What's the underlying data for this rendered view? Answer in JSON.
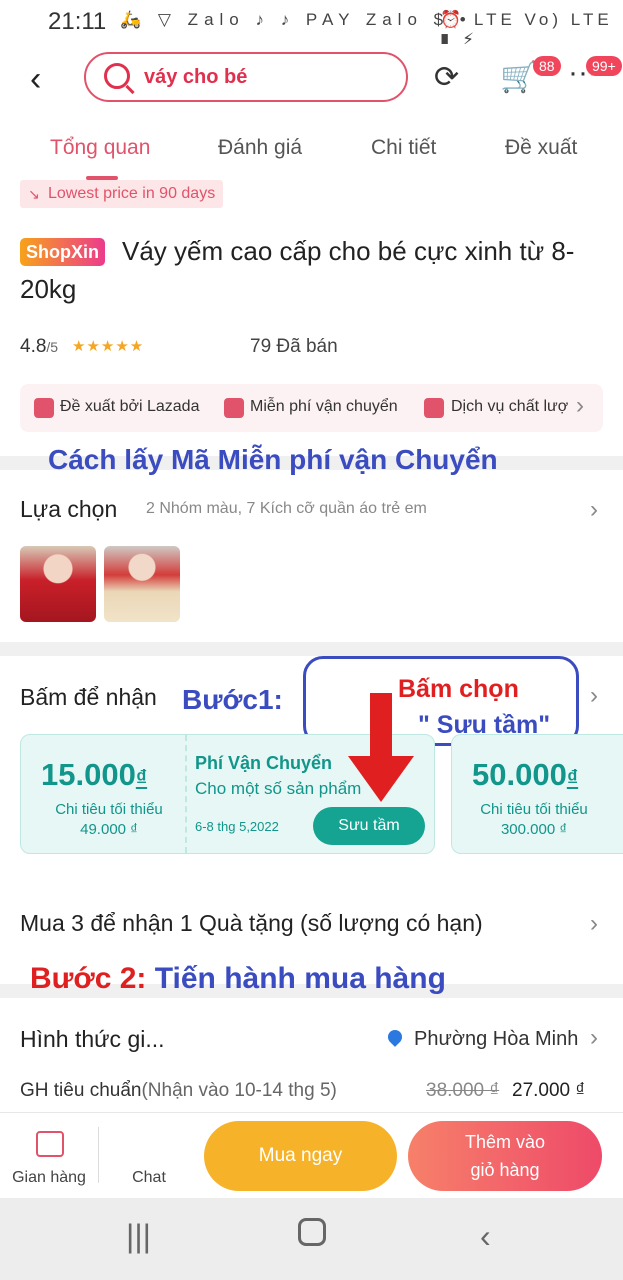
{
  "status_bar": {
    "time": "21:11",
    "left_icons": "🛵 ▽ Zalo ♪ ♪ PAY Zalo $ •",
    "right_icons": "⏰ LTE Vo) LTE ▮ ⚡"
  },
  "header": {
    "search_text": "váy cho bé",
    "cart_badge": "88",
    "more_badge": "99+"
  },
  "tabs": [
    "Tổng quan",
    "Đánh giá",
    "Chi tiết",
    "Đề xuất"
  ],
  "product": {
    "lowest_price": "Lowest price in 90 days",
    "shop_badge": "ShopXin",
    "title": "Váy yếm cao cấp cho bé cực xinh từ 8-20kg",
    "rating": "4.8",
    "rating_max": "/5",
    "stars": "★★★★★",
    "sold": "79  Đã bán",
    "services": [
      "Đề xuất bởi Lazada",
      "Miễn phí vận chuyển",
      "Dịch vụ chất lượ"
    ]
  },
  "guide_title": "Cách lấy Mã Miễn phí vận Chuyển",
  "selection": {
    "label": "Lựa chọn",
    "sub": "2 Nhóm màu, 7 Kích cỡ quần áo trẻ em"
  },
  "vouchers": {
    "label": "Bấm để nhận",
    "step1": "Bước1:",
    "callout_line1": "Bấm chọn",
    "callout_line2": "\" Sưu tầm\"",
    "coupon1": {
      "amount": "15.000",
      "currency": "₫",
      "min_label": "Chi tiêu tối thiểu",
      "min_value": "49.000 ₫"
    },
    "shipping": {
      "name": "Phí Vận Chuyển",
      "sub": "Cho một số sản phẩm",
      "date": "6-8 thg 5,2022",
      "button": "Sưu tầm"
    },
    "coupon2": {
      "amount": "50.000",
      "currency": "₫",
      "min_label": "Chi tiêu tối thiểu",
      "min_value": "300.000 ₫"
    }
  },
  "gift": {
    "label": "Mua 3 để nhận 1 Quà tặng (số lượng có hạn)"
  },
  "step2": {
    "prefix": "Bước 2:",
    "text": " Tiến hành mua hàng"
  },
  "delivery": {
    "label": "Hình thức gi...",
    "location": "Phường Hòa Minh",
    "method": "GH tiêu chuẩn",
    "window": "(Nhận vào 10-14 thg 5)",
    "old_price": "38.000 ₫",
    "new_price": "27.000 ₫"
  },
  "actions": {
    "store": "Gian hàng",
    "chat": "Chat",
    "buy_now": "Mua ngay",
    "add_cart_line1": "Thêm vào",
    "add_cart_line2": "giỏ hàng"
  },
  "colors": {
    "brand_pink": "#e0536a",
    "teal": "#12958a",
    "buy_orange": "#f6b32a",
    "annotation_blue": "#3a4cc0",
    "annotation_red": "#e02020"
  }
}
